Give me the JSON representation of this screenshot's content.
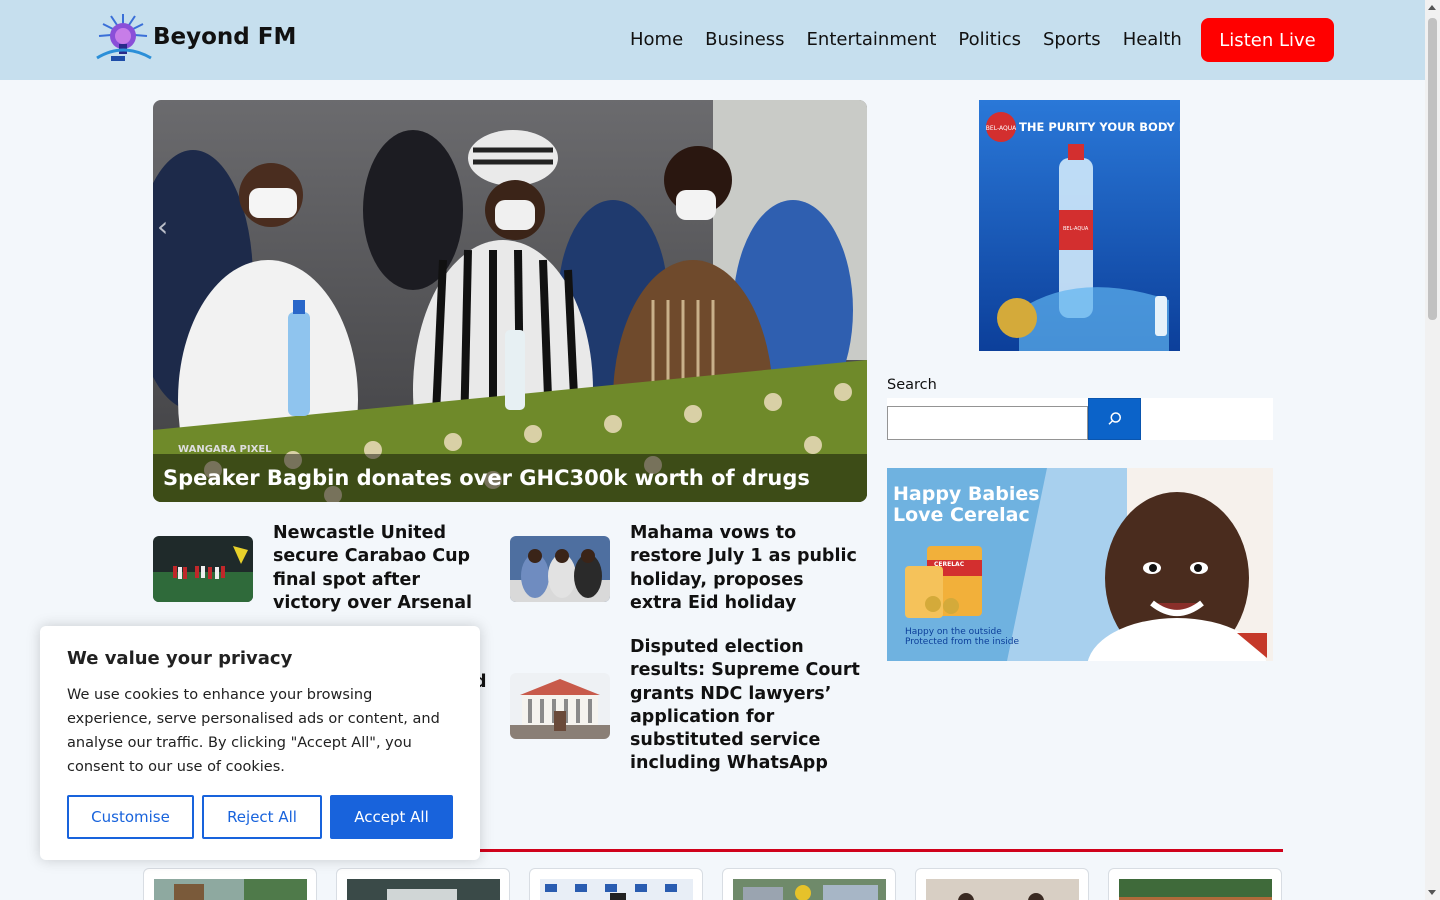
{
  "header": {
    "site_title": "Beyond FM",
    "nav": [
      "Home",
      "Business",
      "Entertainment",
      "Politics",
      "Sports",
      "Health"
    ],
    "listen_live": "Listen Live"
  },
  "hero": {
    "title": "Speaker Bagbin donates over GHC300k worth of drugs",
    "watermark": "WANGARA PIXEL"
  },
  "news": [
    {
      "title": "Newcastle United secure Carabao Cup final spot after victory over Arsenal"
    },
    {
      "title": "Mahama vows to restore July 1 as public holiday, proposes extra Eid holiday"
    },
    {
      "title": "d"
    },
    {
      "title": "Disputed election results: Supreme Court grants NDC lawyers’ application for substituted service including WhatsApp"
    }
  ],
  "sidebar": {
    "ad1_text": "THE PURITY YOUR BODY DESERVES",
    "ad1_brand": "BEL-AQUA",
    "search_label": "Search",
    "search_placeholder": "",
    "ad2_headline_1": "Happy Babies",
    "ad2_headline_2": "Love Cerelac",
    "ad2_tagline_1": "Happy on the outside",
    "ad2_tagline_2": "Protected from the inside",
    "ad2_brand": "CERELAC"
  },
  "cookie": {
    "title": "We value your privacy",
    "text": "We use cookies to enhance your browsing experience, serve personalised ads or content, and analyse our traffic. By clicking \"Accept All\", you consent to our use of cookies.",
    "customise": "Customise",
    "reject": "Reject All",
    "accept": "Accept All"
  },
  "colors": {
    "header_bg": "#c6dfee",
    "listen_live": "#ff0000",
    "accent_blue": "#1863dc",
    "divider_red": "#d0021b"
  }
}
